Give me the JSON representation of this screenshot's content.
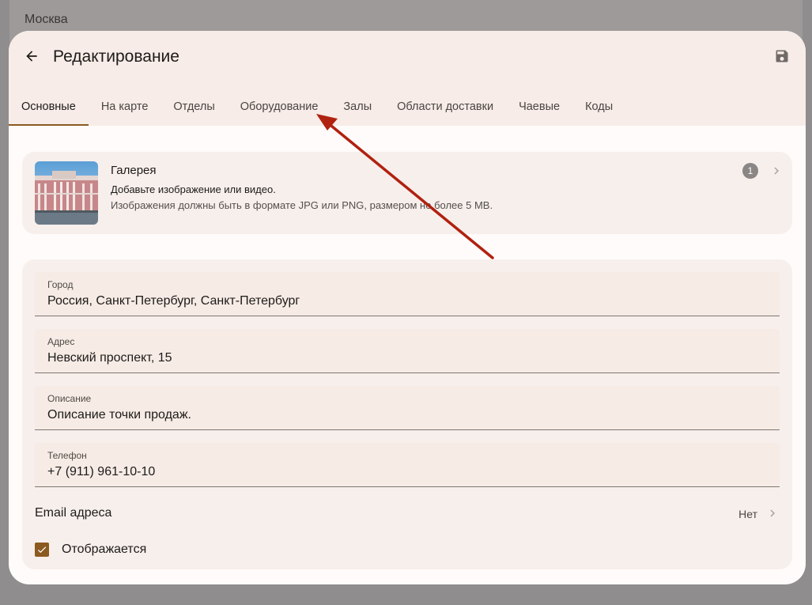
{
  "background": {
    "title": "Москва"
  },
  "header": {
    "title": "Редактирование",
    "back_icon": "arrow-back-icon",
    "save_icon": "save-icon"
  },
  "tabs": [
    {
      "label": "Основные",
      "active": true
    },
    {
      "label": "На карте",
      "active": false
    },
    {
      "label": "Отделы",
      "active": false
    },
    {
      "label": "Оборудование",
      "active": false
    },
    {
      "label": "Залы",
      "active": false
    },
    {
      "label": "Области доставки",
      "active": false
    },
    {
      "label": "Чаевые",
      "active": false
    },
    {
      "label": "Коды",
      "active": false
    }
  ],
  "gallery": {
    "title": "Галерея",
    "subtitle": "Добавьте изображение или видео.",
    "hint": "Изображения должны быть в формате JPG или PNG, размером не более 5 MB.",
    "count": "1"
  },
  "fields": {
    "city": {
      "label": "Город",
      "value": "Россия, Санкт-Петербург, Санкт-Петербург"
    },
    "address": {
      "label": "Адрес",
      "value": "Невский проспект, 15"
    },
    "description": {
      "label": "Описание",
      "value": "Описание точки продаж."
    },
    "phone": {
      "label": "Телефон",
      "value": "+7 (911) 961-10-10"
    }
  },
  "email": {
    "label": "Email адреса",
    "value": "Нет"
  },
  "visible": {
    "label": "Отображается",
    "checked": true
  },
  "colors": {
    "accent": "#8b5a21",
    "header_bg": "#f7ece7",
    "card_bg": "#f7efec",
    "annotation_arrow": "#b0210f"
  }
}
